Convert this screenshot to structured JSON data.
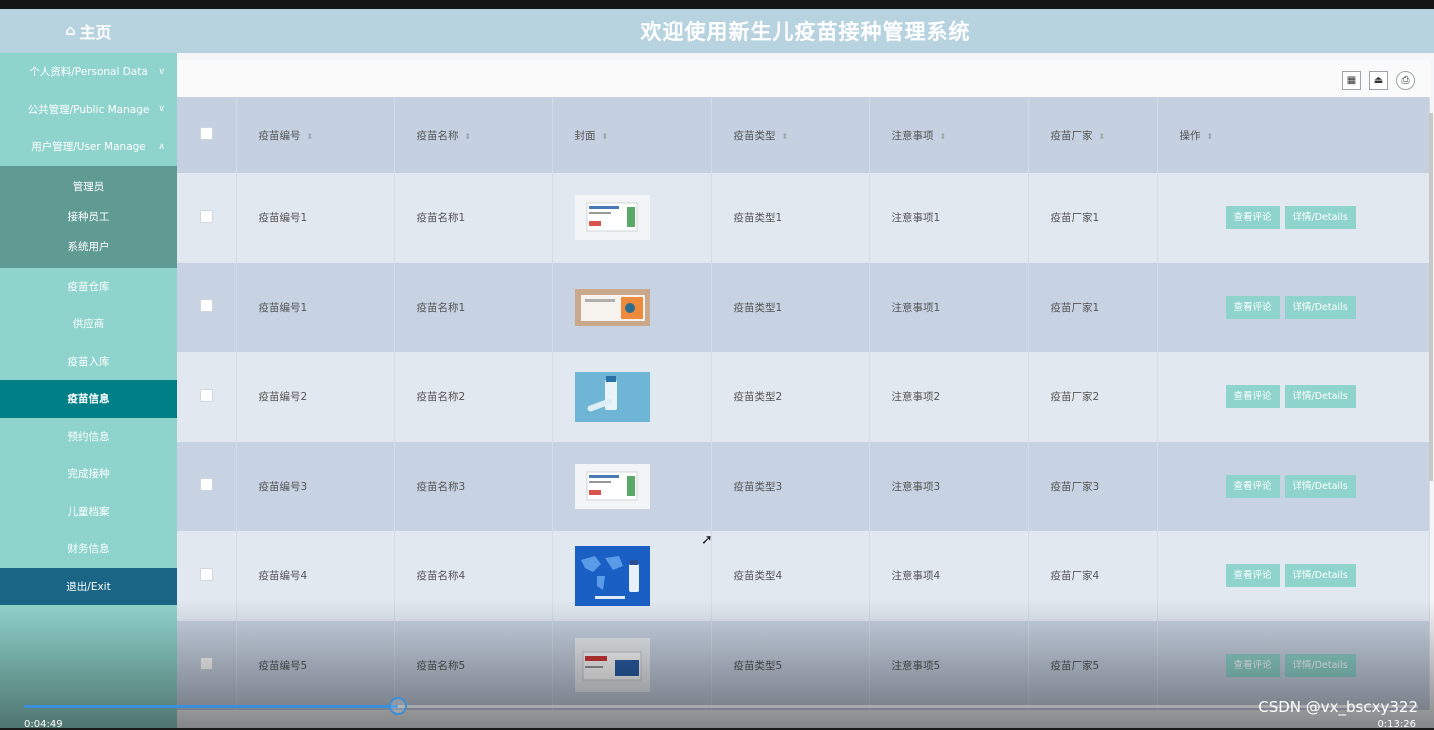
{
  "header": {
    "home_label": "主页",
    "title": "欢迎使用新生儿疫苗接种管理系统"
  },
  "sidebar": {
    "groups": [
      {
        "label": "个人资料/Personal Data"
      },
      {
        "label": "公共管理/Public Manage"
      },
      {
        "label": "用户管理/User Manage"
      }
    ],
    "user_sub": [
      "管理员",
      "接种员工",
      "系统用户"
    ],
    "items": [
      "疫苗仓库",
      "供应商",
      "疫苗入库",
      "疫苗信息",
      "预约信息",
      "完成接种",
      "儿童档案",
      "财务信息"
    ],
    "exit": "退出/Exit",
    "active_item": "疫苗信息"
  },
  "table": {
    "headers": [
      "疫苗编号",
      "疫苗名称",
      "封面",
      "疫苗类型",
      "注意事项",
      "疫苗厂家",
      "操作"
    ],
    "rows": [
      {
        "code": "疫苗编号1",
        "name": "疫苗名称1",
        "type": "疫苗类型1",
        "note": "注意事项1",
        "maker": "疫苗厂家1"
      },
      {
        "code": "疫苗编号1",
        "name": "疫苗名称1",
        "type": "疫苗类型1",
        "note": "注意事项1",
        "maker": "疫苗厂家1"
      },
      {
        "code": "疫苗编号2",
        "name": "疫苗名称2",
        "type": "疫苗类型2",
        "note": "注意事项2",
        "maker": "疫苗厂家2"
      },
      {
        "code": "疫苗编号3",
        "name": "疫苗名称3",
        "type": "疫苗类型3",
        "note": "注意事项3",
        "maker": "疫苗厂家3"
      },
      {
        "code": "疫苗编号4",
        "name": "疫苗名称4",
        "type": "疫苗类型4",
        "note": "注意事项4",
        "maker": "疫苗厂家4"
      },
      {
        "code": "疫苗编号5",
        "name": "疫苗名称5",
        "type": "疫苗类型5",
        "note": "注意事项5",
        "maker": "疫苗厂家5"
      }
    ],
    "btn_review": "查看评论",
    "btn_details": "详情/Details"
  },
  "player": {
    "current_time": "0:04:49",
    "total_time": "0:13:26",
    "progress": 0.268,
    "watermark": "CSDN @vx_bscxy322"
  },
  "colors": {
    "header": "#b7d3df",
    "sidebar": "#8fd4cc",
    "active": "#007f87",
    "exit": "#1a6585",
    "accent_progress": "#3b8fd9"
  }
}
